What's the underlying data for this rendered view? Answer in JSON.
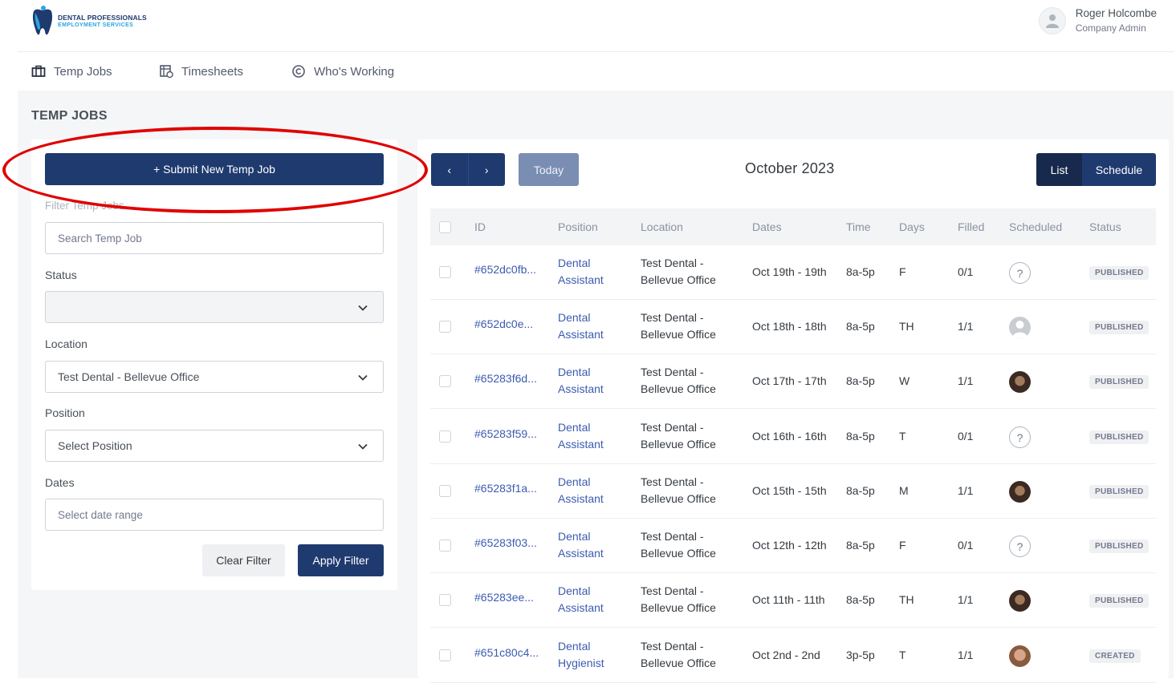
{
  "header": {
    "brand_line1": "DENTAL PROFESSIONALS",
    "brand_line2": "EMPLOYMENT SERVICES",
    "user_name": "Roger Holcombe",
    "user_role": "Company Admin"
  },
  "nav": {
    "items": [
      {
        "label": "Temp Jobs",
        "icon": "briefcase-icon"
      },
      {
        "label": "Timesheets",
        "icon": "timesheet-icon"
      },
      {
        "label": "Who's Working",
        "icon": "copyright-circle-icon"
      }
    ]
  },
  "page": {
    "title": "TEMP JOBS"
  },
  "filter": {
    "submit_label": "+ Submit New Temp Job",
    "filter_label": "Filter Temp Jobs",
    "search_placeholder": "Search Temp Job",
    "status_label": "Status",
    "status_value": "",
    "location_label": "Location",
    "location_value": "Test Dental - Bellevue Office",
    "position_label": "Position",
    "position_value": "Select Position",
    "dates_label": "Dates",
    "dates_placeholder": "Select date range",
    "clear_label": "Clear Filter",
    "apply_label": "Apply Filter"
  },
  "calendar": {
    "prev": "‹",
    "next": "›",
    "today_label": "Today",
    "month": "October 2023",
    "view_list": "List",
    "view_schedule": "Schedule"
  },
  "table": {
    "headers": {
      "id": "ID",
      "position": "Position",
      "location": "Location",
      "dates": "Dates",
      "time": "Time",
      "days": "Days",
      "filled": "Filled",
      "scheduled": "Scheduled",
      "status": "Status"
    },
    "rows": [
      {
        "id": "#652dc0fb...",
        "pos1": "Dental",
        "pos2": "Assistant",
        "loc1": "Test Dental -",
        "loc2": "Bellevue Office",
        "dates": "Oct 19th - 19th",
        "time": "8a-5p",
        "days": "F",
        "filled": "0/1",
        "scheduled": "unknown",
        "status": "PUBLISHED"
      },
      {
        "id": "#652dc0e...",
        "pos1": "Dental",
        "pos2": "Assistant",
        "loc1": "Test Dental -",
        "loc2": "Bellevue Office",
        "dates": "Oct 18th - 18th",
        "time": "8a-5p",
        "days": "TH",
        "filled": "1/1",
        "scheduled": "default",
        "status": "PUBLISHED"
      },
      {
        "id": "#65283f6d...",
        "pos1": "Dental",
        "pos2": "Assistant",
        "loc1": "Test Dental -",
        "loc2": "Bellevue Office",
        "dates": "Oct 17th - 17th",
        "time": "8a-5p",
        "days": "W",
        "filled": "1/1",
        "scheduled": "photo",
        "status": "PUBLISHED"
      },
      {
        "id": "#65283f59...",
        "pos1": "Dental",
        "pos2": "Assistant",
        "loc1": "Test Dental -",
        "loc2": "Bellevue Office",
        "dates": "Oct 16th - 16th",
        "time": "8a-5p",
        "days": "T",
        "filled": "0/1",
        "scheduled": "unknown",
        "status": "PUBLISHED"
      },
      {
        "id": "#65283f1a...",
        "pos1": "Dental",
        "pos2": "Assistant",
        "loc1": "Test Dental -",
        "loc2": "Bellevue Office",
        "dates": "Oct 15th - 15th",
        "time": "8a-5p",
        "days": "M",
        "filled": "1/1",
        "scheduled": "photo",
        "status": "PUBLISHED"
      },
      {
        "id": "#65283f03...",
        "pos1": "Dental",
        "pos2": "Assistant",
        "loc1": "Test Dental -",
        "loc2": "Bellevue Office",
        "dates": "Oct 12th - 12th",
        "time": "8a-5p",
        "days": "F",
        "filled": "0/1",
        "scheduled": "unknown",
        "status": "PUBLISHED"
      },
      {
        "id": "#65283ee...",
        "pos1": "Dental",
        "pos2": "Assistant",
        "loc1": "Test Dental -",
        "loc2": "Bellevue Office",
        "dates": "Oct 11th - 11th",
        "time": "8a-5p",
        "days": "TH",
        "filled": "1/1",
        "scheduled": "photo",
        "status": "PUBLISHED"
      },
      {
        "id": "#651c80c4...",
        "pos1": "Dental",
        "pos2": "Hygienist",
        "loc1": "Test Dental -",
        "loc2": "Bellevue Office",
        "dates": "Oct 2nd - 2nd",
        "time": "3p-5p",
        "days": "T",
        "filled": "1/1",
        "scheduled": "photo2",
        "status": "CREATED"
      }
    ]
  },
  "colors": {
    "primary": "#1f3a6e",
    "link": "#3b5bb0",
    "annotation": "#e00000"
  }
}
